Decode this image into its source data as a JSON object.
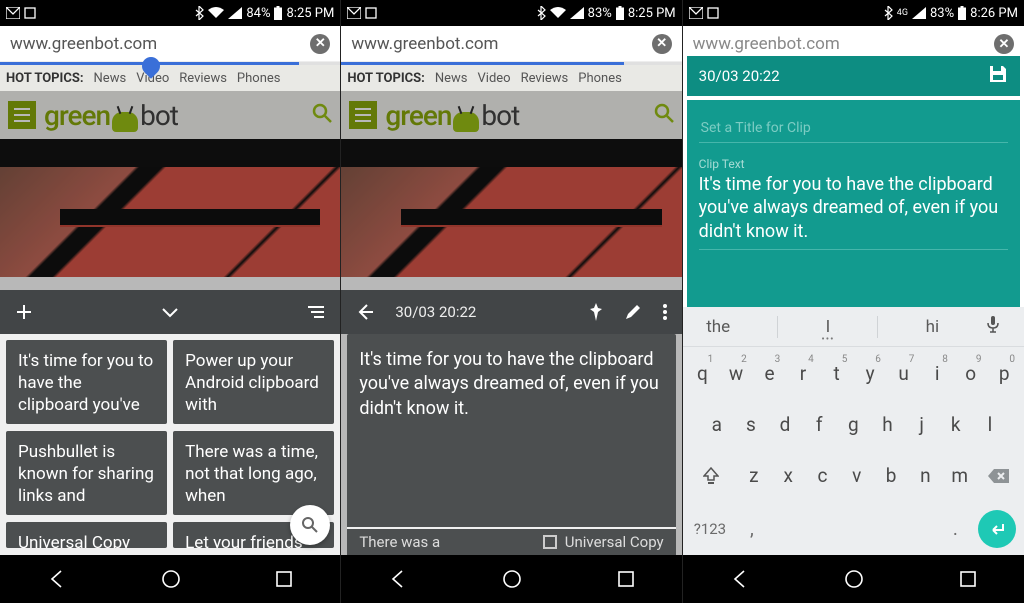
{
  "status": {
    "p1": {
      "battery": "84%",
      "time": "8:25 PM"
    },
    "p2": {
      "battery": "83%",
      "time": "8:25 PM"
    },
    "p3": {
      "battery": "83%",
      "time": "8:26 PM"
    }
  },
  "url": "www.greenbot.com",
  "hot_topics_label": "HOT TOPICS:",
  "hot_topics": [
    "News",
    "Video",
    "Reviews",
    "Phones"
  ],
  "brand_green": "green",
  "brand_bot": "bot",
  "clip_timestamp": "30/03 20:22",
  "clip_text": "It's time for you to have the clipboard you've always dreamed of, even if you didn't know it.",
  "cards": [
    "It's time for you to have the clipboard you've",
    "Power up your Android clipboard with",
    "Pushbullet is known for sharing links and",
    "There was a time, not that long ago, when",
    "Universal Copy",
    "Let your friends"
  ],
  "card_more": "There was a",
  "universal_copy": "Universal Copy",
  "editor": {
    "header": "30/03 20:22",
    "title_hint": "Set a Title for Clip",
    "text_label": "Clip Text"
  },
  "suggestions": [
    "the",
    "I",
    "hi"
  ],
  "kbd": {
    "row1": [
      {
        "k": "q",
        "n": "1"
      },
      {
        "k": "w",
        "n": "2"
      },
      {
        "k": "e",
        "n": "3"
      },
      {
        "k": "r",
        "n": "4"
      },
      {
        "k": "t",
        "n": "5"
      },
      {
        "k": "y",
        "n": "6"
      },
      {
        "k": "u",
        "n": "7"
      },
      {
        "k": "i",
        "n": "8"
      },
      {
        "k": "o",
        "n": "9"
      },
      {
        "k": "p",
        "n": "0"
      }
    ],
    "row2": [
      "a",
      "s",
      "d",
      "f",
      "g",
      "h",
      "j",
      "k",
      "l"
    ],
    "row3": [
      "z",
      "x",
      "c",
      "v",
      "b",
      "n",
      "m"
    ],
    "symkey": "?123",
    "comma": ",",
    "period": "."
  }
}
